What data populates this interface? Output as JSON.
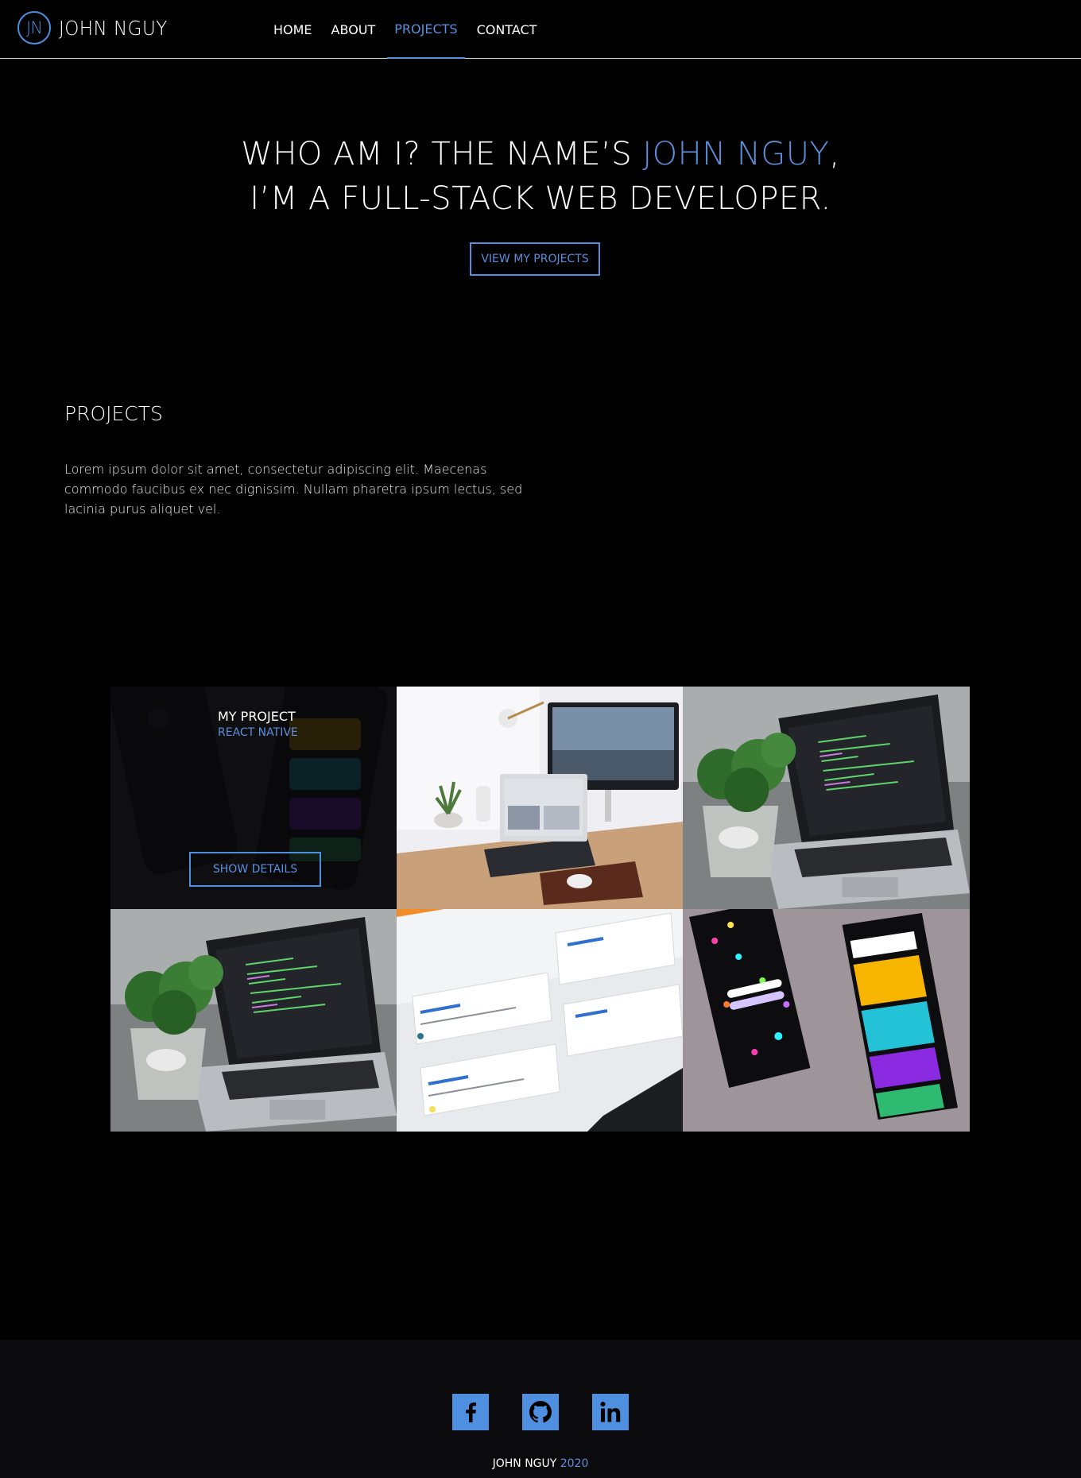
{
  "header": {
    "logo_text": "JN",
    "brand": "JOHN NGUY",
    "nav": [
      {
        "label": "HOME",
        "active": false
      },
      {
        "label": "ABOUT",
        "active": false
      },
      {
        "label": "PROJECTS",
        "active": true
      },
      {
        "label": "CONTACT",
        "active": false
      }
    ]
  },
  "hero": {
    "line1_prefix": "WHO AM I? THE NAME’S ",
    "line1_accent": "JOHN NGUY",
    "line1_suffix": ",",
    "line2": "I’M A FULL-STACK WEB DEVELOPER.",
    "button": "VIEW MY PROJECTS"
  },
  "projects": {
    "title": "PROJECTS",
    "description": "Lorem ipsum dolor sit amet, consectetur adipiscing elit. Maecenas commodo faucibus ex nec dignissim. Nullam pharetra ipsum lectus, sed lacinia purus aliquet vel.",
    "featured": {
      "title": "MY PROJECT",
      "subtitle": "REACT NATIVE",
      "button": "SHOW DETAILS"
    },
    "tiles": [
      {
        "image": "mobile-app-screens"
      },
      {
        "image": "desk-monitor-laptop"
      },
      {
        "image": "laptop-plant-code"
      },
      {
        "image": "laptop-plant-code"
      },
      {
        "image": "github-repositories-screen"
      },
      {
        "image": "byte-app-phones"
      }
    ]
  },
  "footer": {
    "social": [
      {
        "name": "facebook-icon"
      },
      {
        "name": "github-icon"
      },
      {
        "name": "linkedin-icon"
      }
    ],
    "copyright_name": "JOHN NGUY",
    "copyright_year": "2020"
  },
  "colors": {
    "accent": "#5b8fdc",
    "background": "#000000",
    "footer_background": "#0b0a0c"
  }
}
